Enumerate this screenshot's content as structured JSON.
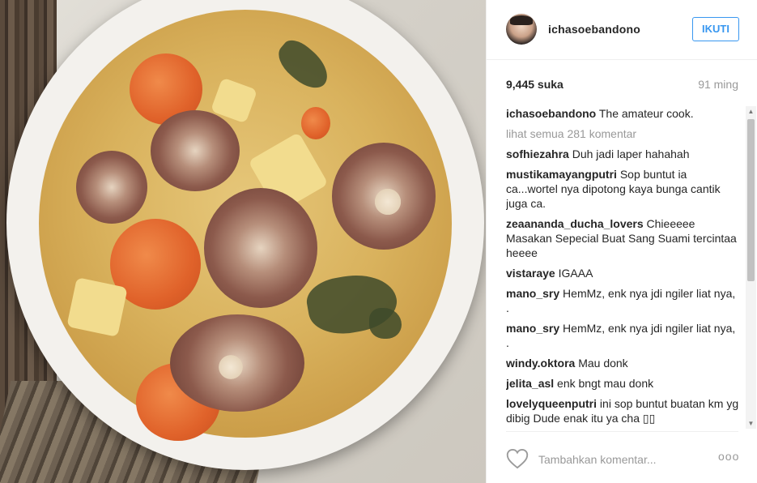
{
  "post": {
    "username": "ichasoebandono",
    "follow_label": "IKUTI",
    "likes": "9,445 suka",
    "time_ago": "91 ming"
  },
  "caption": {
    "author": "ichasoebandono",
    "text": "The amateur cook."
  },
  "view_all": "lihat semua 281 komentar",
  "comments": [
    {
      "author": "sofhiezahra",
      "text": "Duh jadi laper hahahah"
    },
    {
      "author": "mustikamayangputri",
      "text": "Sop buntut ia ca...wortel nya dipotong kaya bunga cantik juga ca."
    },
    {
      "author": "zeaananda_ducha_lovers",
      "text": "Chieeeee Masakan Sepecial Buat Sang Suami tercintaa heeee"
    },
    {
      "author": "vistaraye",
      "text": "IGAAA"
    },
    {
      "author": "mano_sry",
      "text": "HemMz, enk nya jdi ngiler liat nya, ."
    },
    {
      "author": "mano_sry",
      "text": "HemMz, enk nya jdi ngiler liat nya, ."
    },
    {
      "author": "windy.oktora",
      "text": "Mau donk"
    },
    {
      "author": "jelita_asl",
      "text": "enk bngt mau donk"
    },
    {
      "author": "lovelyqueenputri",
      "text": "ini sop buntut buatan km yg dibig Dude enak itu ya cha ▯▯"
    }
  ],
  "footer": {
    "comment_placeholder": "Tambahkan komentar...",
    "more_label": "ooo"
  },
  "icons": {
    "like": "heart-icon",
    "more": "more-options-icon",
    "scroll_up": "scroll-up-arrow",
    "scroll_down": "scroll-down-arrow"
  },
  "colors": {
    "accent": "#3897f0",
    "text": "#262626",
    "muted": "#999999",
    "border": "#efefef"
  }
}
